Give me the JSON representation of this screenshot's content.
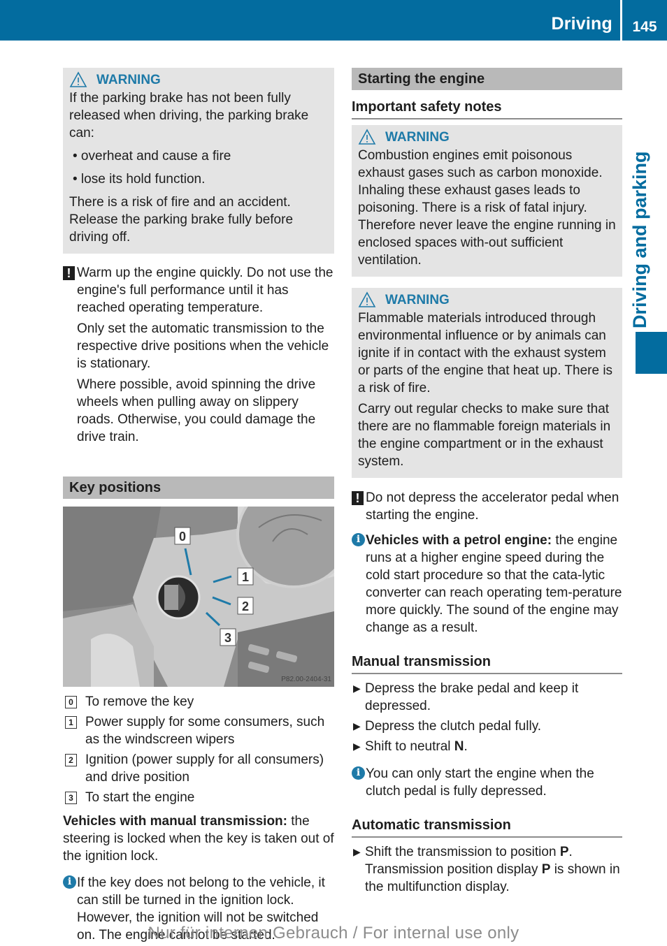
{
  "header": {
    "section": "Driving",
    "page_number": "145",
    "side_tab": "Driving and parking"
  },
  "colors": {
    "brand_blue": "#036c9f",
    "warning_blue": "#1e7aa8",
    "box_gray": "#e4e4e4",
    "section_gray": "#b9b9b9"
  },
  "left": {
    "warning": {
      "label": "WARNING",
      "intro": "If the parking brake has not been fully released when driving, the parking brake can:",
      "bullets": [
        "• overheat and cause a fire",
        "• lose its hold function."
      ],
      "outro": "There is a risk of fire and an accident. Release the parking brake fully before driving off."
    },
    "note": {
      "icon": "!",
      "p1": "Warm up the engine quickly. Do not use the engine's full performance until it has reached operating temperature.",
      "p2": "Only set the automatic transmission to the respective drive positions when the vehicle is stationary.",
      "p3": "Where possible, avoid spinning the drive wheels when pulling away on slippery roads. Otherwise, you could damage the drive train."
    },
    "key_positions": {
      "title": "Key positions",
      "figure": {
        "callouts": [
          "0",
          "1",
          "2",
          "3"
        ],
        "code": "P82.00-2404-31"
      },
      "legend": [
        {
          "num": "0",
          "text": "To remove the key"
        },
        {
          "num": "1",
          "text": "Power supply for some consumers, such as the windscreen wipers"
        },
        {
          "num": "2",
          "text": "Ignition (power supply for all consumers) and drive position"
        },
        {
          "num": "3",
          "text": "To start the engine"
        }
      ],
      "manual_bold": "Vehicles with manual transmission:",
      "manual_text": " the steering is locked when the key is taken out of the ignition lock.",
      "info_icon": "i",
      "info_text": "If the key does not belong to the vehicle, it can still be turned in the ignition lock. However, the ignition will not be switched on. The engine cannot be started."
    }
  },
  "right": {
    "title": "Starting the engine",
    "safety_title": "Important safety notes",
    "warning1": {
      "label": "WARNING",
      "text": "Combustion engines emit poisonous exhaust gases such as carbon monoxide. Inhaling these exhaust gases leads to poisoning. There is a risk of fatal injury. Therefore never leave the engine running in enclosed spaces with-out sufficient ventilation."
    },
    "warning2": {
      "label": "WARNING",
      "p1": "Flammable materials introduced through environmental influence or by animals can ignite if in contact with the exhaust system or parts of the engine that heat up. There is a risk of fire.",
      "p2": "Carry out regular checks to make sure that there are no flammable foreign materials in the engine compartment or in the exhaust system."
    },
    "note": {
      "icon": "!",
      "text": "Do not depress the accelerator pedal when starting the engine."
    },
    "petrol_info": {
      "icon": "i",
      "bold": "Vehicles with a petrol engine:",
      "text": " the engine runs at a higher engine speed during the cold start procedure so that the cata-lytic converter can reach operating tem-perature more quickly. The sound of the engine may change as a result."
    },
    "manual": {
      "title": "Manual transmission",
      "steps": [
        {
          "text": "Depress the brake pedal and keep it depressed.",
          "bold": "",
          "after": ""
        },
        {
          "text": "Depress the clutch pedal fully.",
          "bold": "",
          "after": ""
        },
        {
          "text": "Shift to neutral ",
          "bold": "N",
          "after": "."
        }
      ],
      "info_icon": "i",
      "info_text": "You can only start the engine when the clutch pedal is fully depressed."
    },
    "automatic": {
      "title": "Automatic transmission",
      "step_a": "Shift the transmission to position ",
      "step_b": "P",
      "step_c": ". Transmission position display ",
      "step_d": "P",
      "step_e": " is shown in the multifunction display."
    }
  },
  "footer": "Nur für internen Gebrauch / For internal use only"
}
